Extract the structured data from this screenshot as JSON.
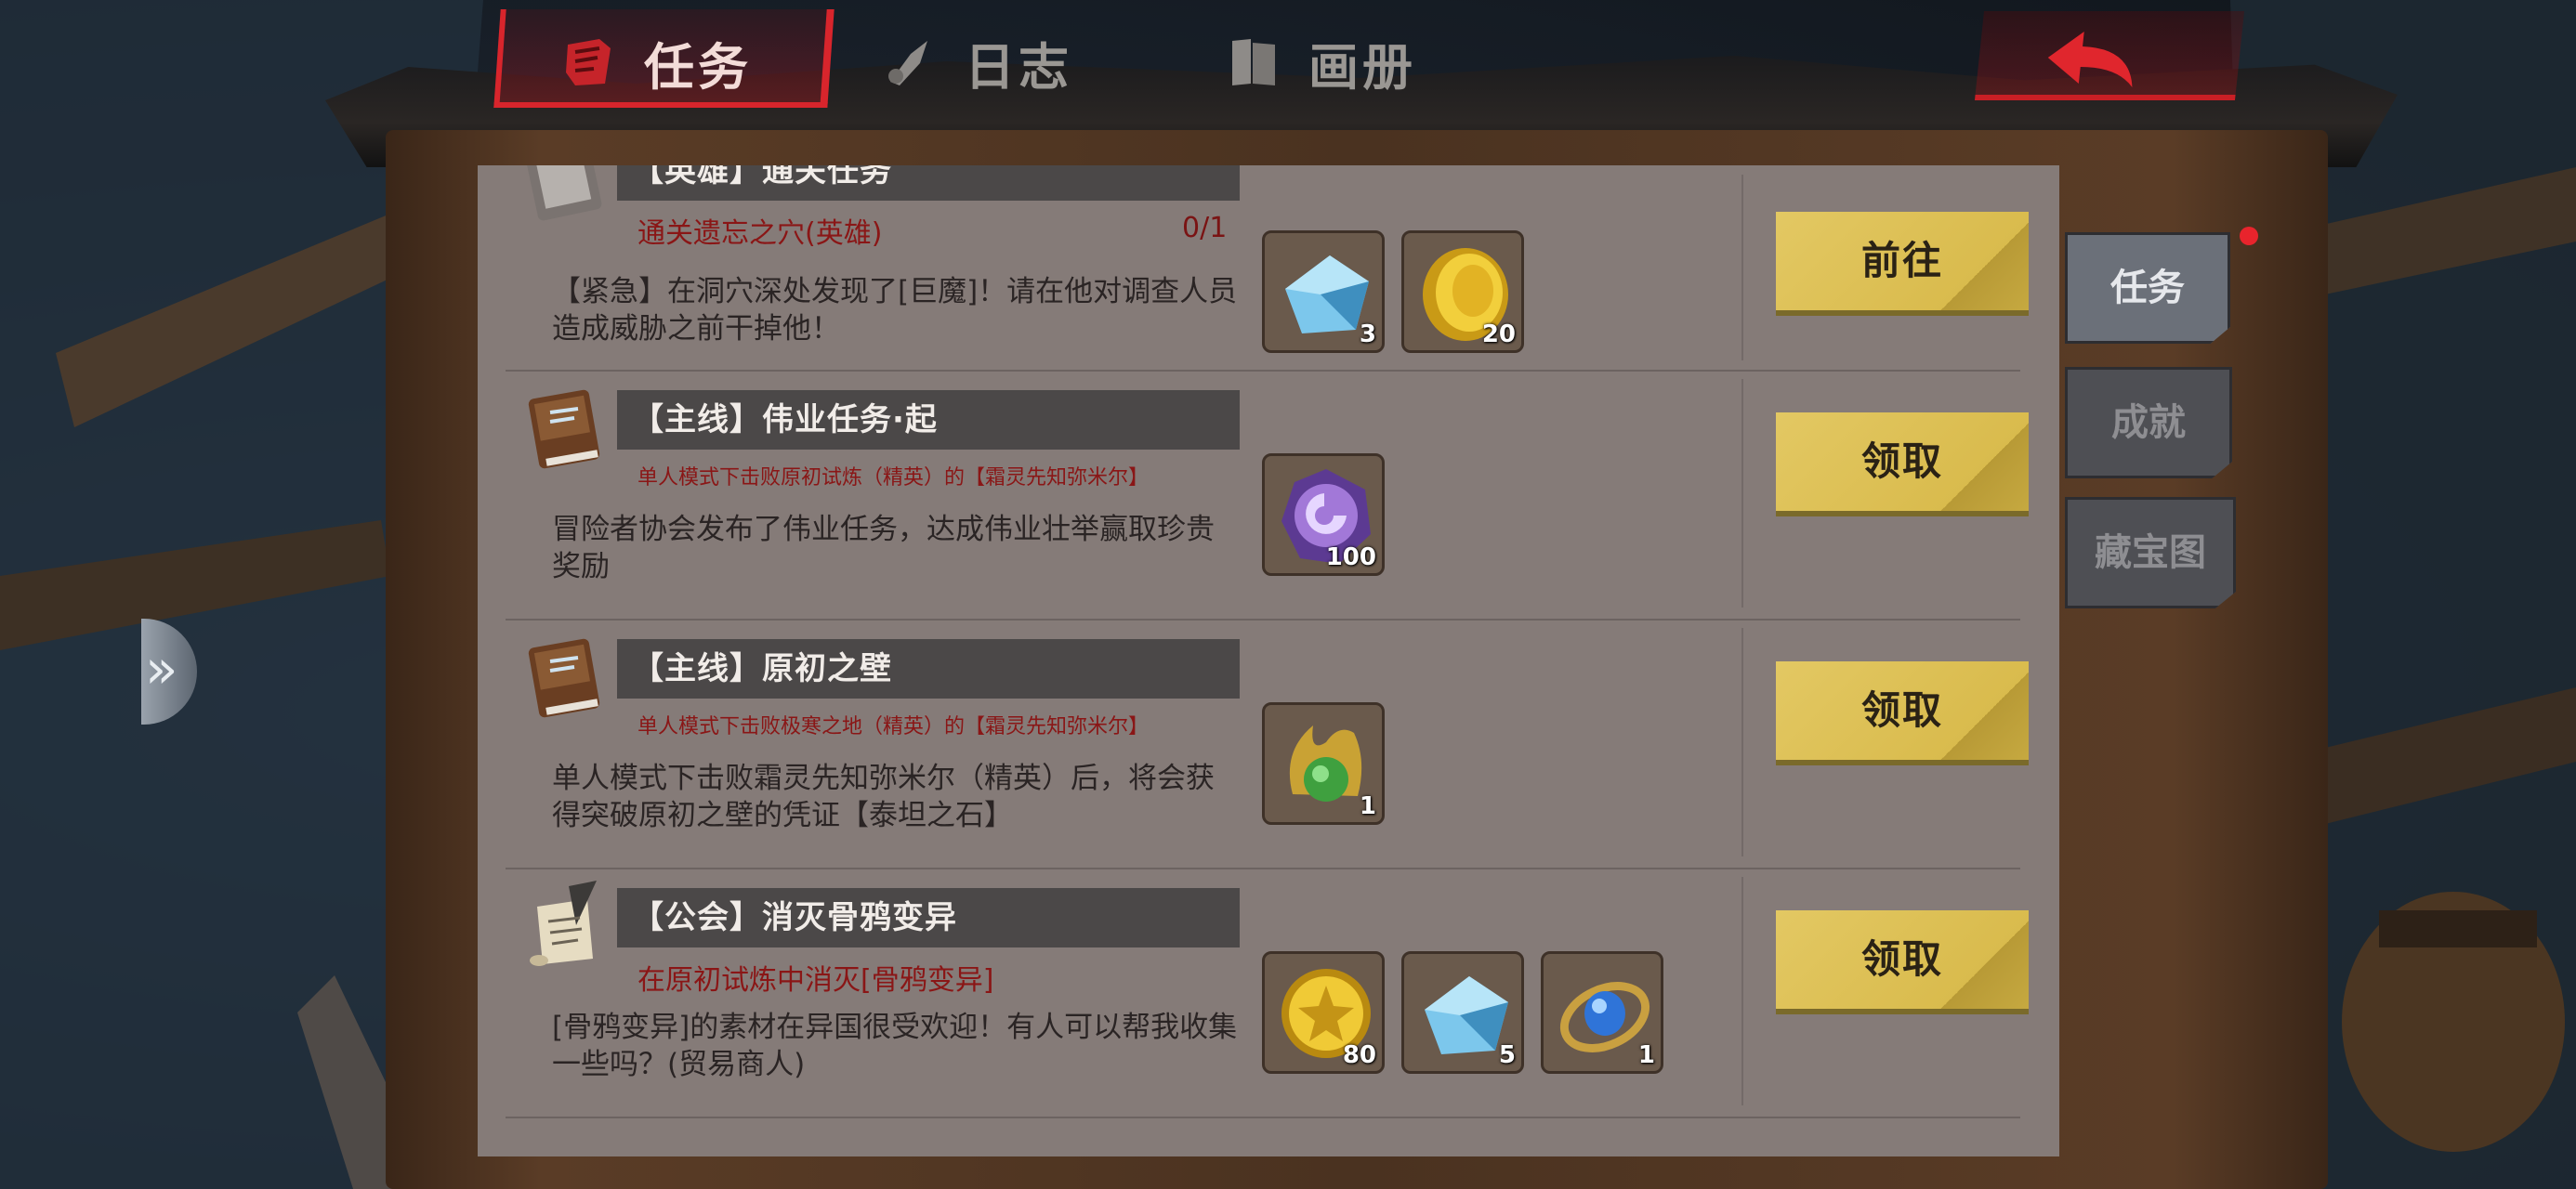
{
  "header": {
    "tabs": [
      {
        "label": "任务",
        "icon": "quest-scroll-icon",
        "active": true
      },
      {
        "label": "日志",
        "icon": "journal-quill-icon",
        "active": false
      },
      {
        "label": "画册",
        "icon": "album-book-icon",
        "active": false
      }
    ],
    "back_icon": "back-arrow-icon"
  },
  "side_tabs": [
    {
      "label": "任务",
      "active": true,
      "notification": true
    },
    {
      "label": "成就",
      "active": false,
      "notification": false
    },
    {
      "label": "藏宝图",
      "active": false,
      "notification": false
    }
  ],
  "quests": [
    {
      "title": "【英雄】通关任务",
      "icon": "quest-book-icon",
      "condition": "通关遗忘之穴(英雄)",
      "progress": "0/1",
      "description": "【紧急】在洞穴深处发现了[巨魔]！请在他对调查人员造成威胁之前干掉他！",
      "rewards": [
        {
          "icon": "blue-crystal-icon",
          "qty": "3"
        },
        {
          "icon": "gold-coin-icon",
          "qty": "20"
        }
      ],
      "action": "前往"
    },
    {
      "title": "【主线】伟业任务·起",
      "icon": "quest-book-icon",
      "condition": "单人模式下击败原初试炼（精英）的【霜灵先知弥米尔】",
      "progress": "",
      "description": "冒险者协会发布了伟业任务，达成伟业壮举赢取珍贵奖励",
      "rewards": [
        {
          "icon": "purple-medal-icon",
          "qty": "100"
        }
      ],
      "action": "领取"
    },
    {
      "title": "【主线】原初之壁",
      "icon": "quest-book-icon",
      "condition": "单人模式下击败极寒之地（精英）的【霜灵先知弥米尔】",
      "progress": "",
      "description": "单人模式下击败霜灵先知弥米尔（精英）后，将会获得突破原初之壁的凭证【泰坦之石】",
      "rewards": [
        {
          "icon": "titan-stone-icon",
          "qty": "1"
        }
      ],
      "action": "领取"
    },
    {
      "title": "【公会】消灭骨鸦变异",
      "icon": "quest-scroll-quill-icon",
      "condition": "在原初试炼中消灭[骨鸦变异]",
      "progress": "",
      "description": "[骨鸦变异]的素材在异国很受欢迎！有人可以帮我收集一些吗？(贸易商人)",
      "rewards": [
        {
          "icon": "gold-emblem-coin-icon",
          "qty": "80"
        },
        {
          "icon": "blue-crystal-icon",
          "qty": "5"
        },
        {
          "icon": "sapphire-ring-icon",
          "qty": "1"
        }
      ],
      "action": "领取"
    }
  ],
  "colors": {
    "accent_red": "#d8252c",
    "button_gold": "#dcbf52",
    "panel_bg": "#857b78"
  }
}
